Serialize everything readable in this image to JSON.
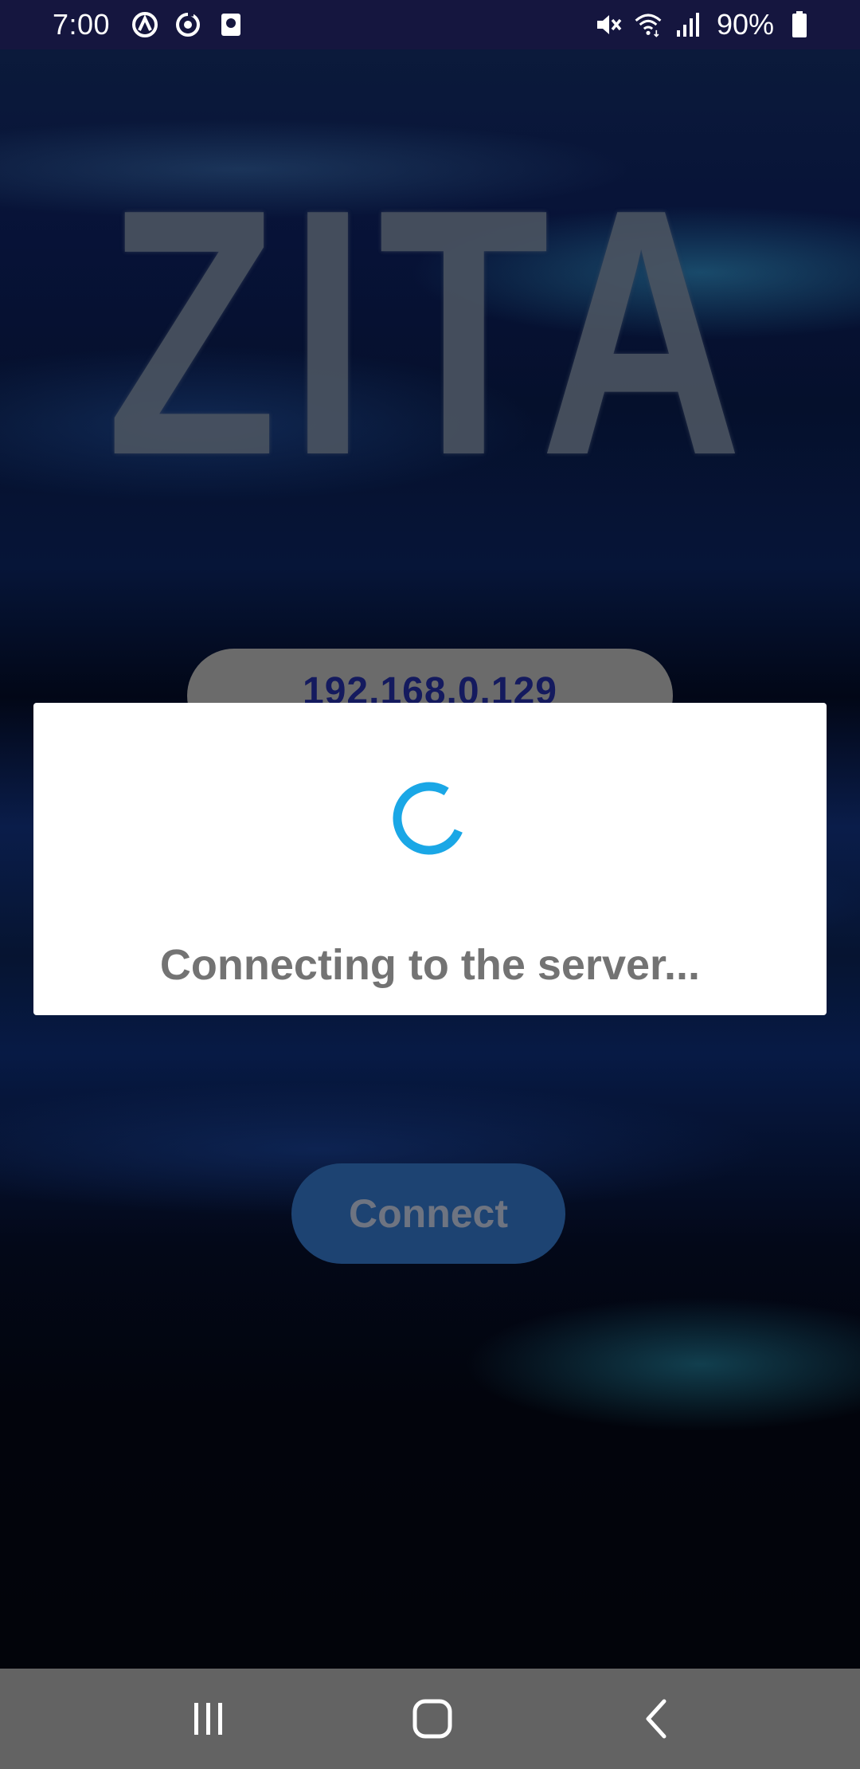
{
  "status_bar": {
    "time": "7:00",
    "left_icons": [
      "vpn-icon",
      "sync-icon",
      "screenshot-icon"
    ],
    "right_icons": [
      "mute-icon",
      "wifi-icon",
      "signal-icon",
      "battery-icon"
    ],
    "battery_percent": "90%"
  },
  "app": {
    "logo_text": "ZITA",
    "server_address": "192.168.0.129",
    "connect_label": "Connect"
  },
  "dialog": {
    "message": "Connecting to the server...",
    "spinner_color": "#1aa7e6"
  },
  "nav_bar": {
    "buttons": [
      "recents-icon",
      "home-icon",
      "back-icon"
    ]
  },
  "colors": {
    "status_bar_bg": "#15163f",
    "nav_bar_bg": "#636363",
    "ip_text": "#141a5e",
    "spinner": "#1aa7e6"
  }
}
